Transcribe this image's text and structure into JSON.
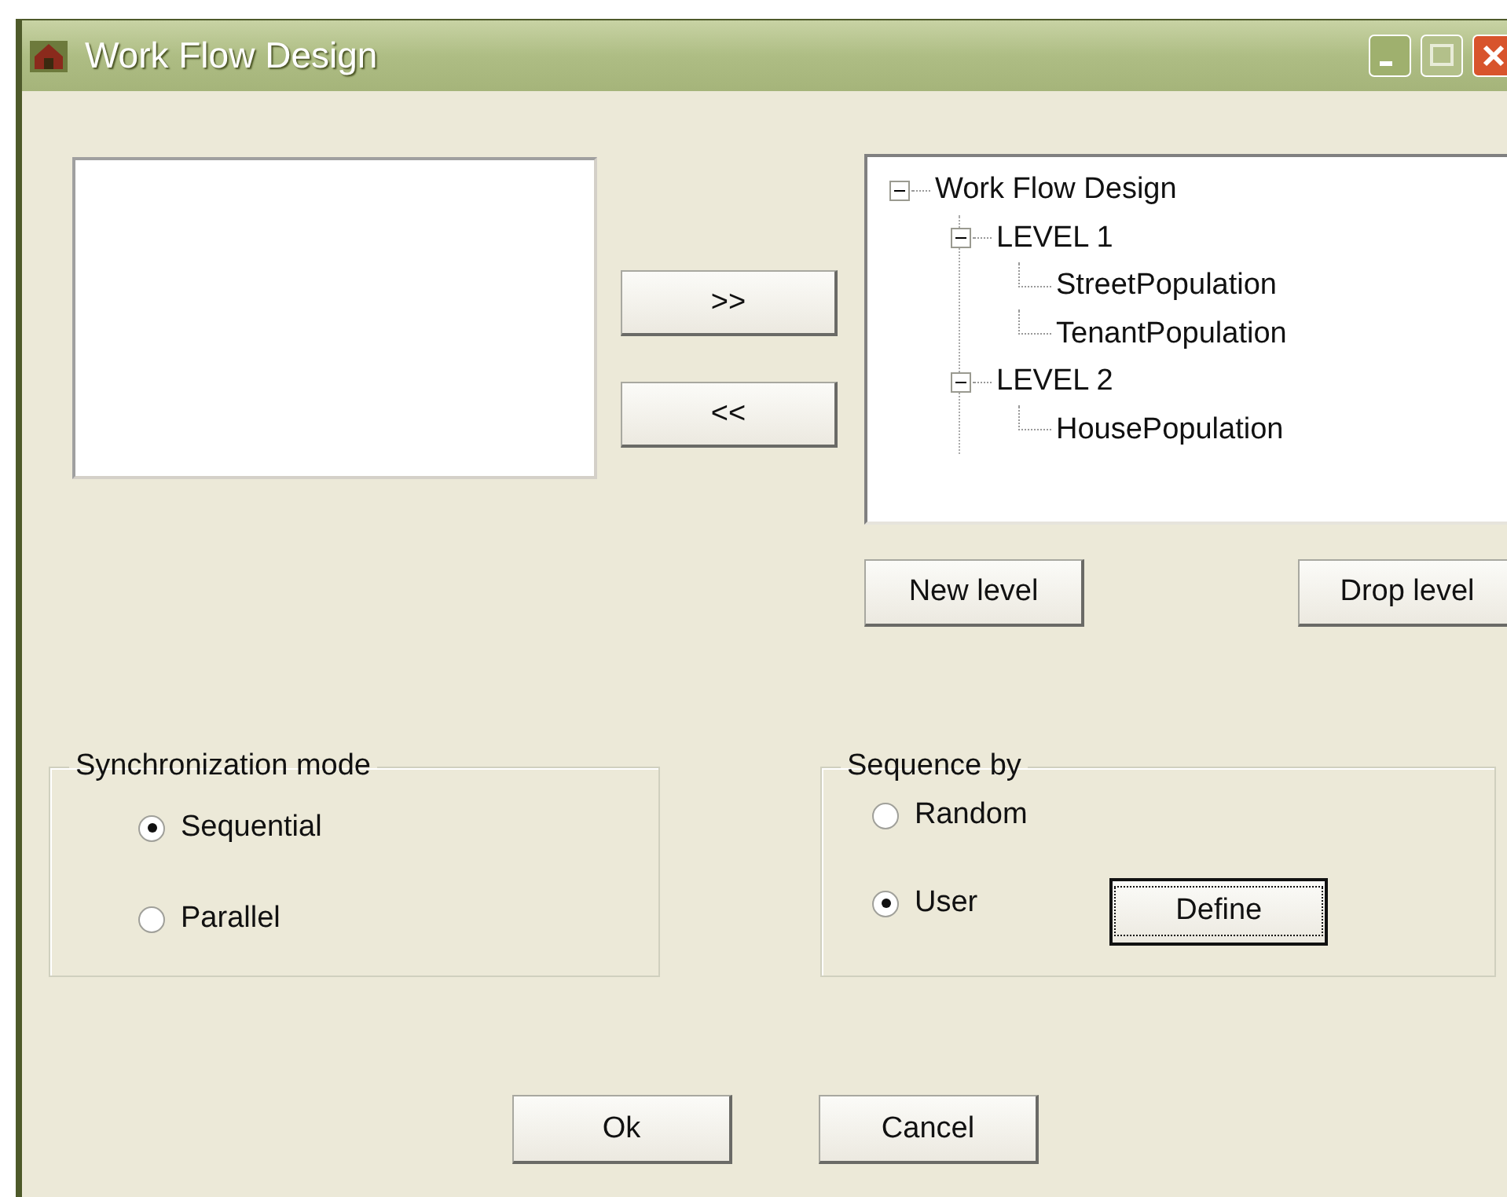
{
  "window": {
    "title": "Work Flow Design"
  },
  "move_buttons": [
    ">>",
    "<<"
  ],
  "tree": {
    "label": "Work Flow Design",
    "expanded": true,
    "children": [
      {
        "label": "LEVEL 1",
        "expanded": true,
        "children": [
          {
            "label": "StreetPopulation"
          },
          {
            "label": "TenantPopulation"
          }
        ]
      },
      {
        "label": "LEVEL 2",
        "expanded": true,
        "children": [
          {
            "label": "HousePopulation"
          }
        ]
      }
    ]
  },
  "level_buttons": [
    "New level",
    "Drop level"
  ],
  "synchronization_mode": {
    "title": "Synchronization  mode",
    "options": [
      {
        "label": "Sequential",
        "selected": true
      },
      {
        "label": "Parallel",
        "selected": false
      }
    ]
  },
  "sequence_by": {
    "title": "Sequence by",
    "options": [
      {
        "label": "Random",
        "selected": false
      },
      {
        "label": "User",
        "selected": true
      }
    ],
    "define_button": {
      "label": "Define",
      "focused": true
    }
  },
  "buttons": [
    "Ok",
    "Cancel"
  ]
}
